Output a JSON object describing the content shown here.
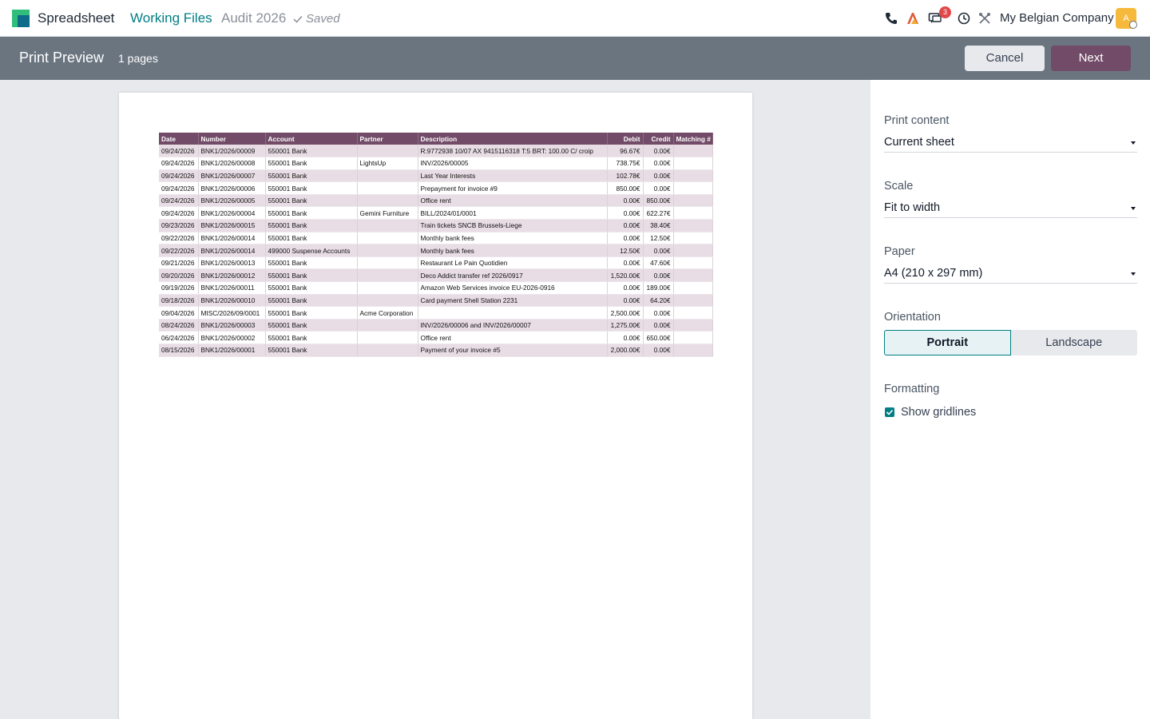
{
  "topbar": {
    "app_name": "Spreadsheet",
    "breadcrumb": [
      "Working Files",
      "Audit 2026"
    ],
    "saved_label": "Saved",
    "messages_badge": "3",
    "company": "My Belgian Company",
    "avatar_letter": "A",
    "colors": {
      "brand": "#714b67",
      "accent": "#017e84"
    }
  },
  "controlbar": {
    "title": "Print Preview",
    "pages": "1 pages",
    "cancel_label": "Cancel",
    "next_label": "Next"
  },
  "sheet": {
    "headers": [
      "Date",
      "Number",
      "Account",
      "Partner",
      "Description",
      "Debit",
      "Credit",
      "Matching #"
    ],
    "rows": [
      [
        "09/24/2026",
        "BNK1/2026/00009",
        "550001 Bank",
        "",
        "R:9772938 10/07 AX 9415116318 T:5 BRT: 100.00 C/ croip",
        "96.67€",
        "0.00€",
        ""
      ],
      [
        "09/24/2026",
        "BNK1/2026/00008",
        "550001 Bank",
        "LightsUp",
        "INV/2026/00005",
        "738.75€",
        "0.00€",
        ""
      ],
      [
        "09/24/2026",
        "BNK1/2026/00007",
        "550001 Bank",
        "",
        "Last Year Interests",
        "102.78€",
        "0.00€",
        ""
      ],
      [
        "09/24/2026",
        "BNK1/2026/00006",
        "550001 Bank",
        "",
        "Prepayment for invoice #9",
        "850.00€",
        "0.00€",
        ""
      ],
      [
        "09/24/2026",
        "BNK1/2026/00005",
        "550001 Bank",
        "",
        "Office rent",
        "0.00€",
        "850.00€",
        ""
      ],
      [
        "09/24/2026",
        "BNK1/2026/00004",
        "550001 Bank",
        "Gemini Furniture",
        "BILL/2024/01/0001",
        "0.00€",
        "622.27€",
        ""
      ],
      [
        "09/23/2026",
        "BNK1/2026/00015",
        "550001 Bank",
        "",
        "Train tickets SNCB Brussels-Liege",
        "0.00€",
        "38.40€",
        ""
      ],
      [
        "09/22/2026",
        "BNK1/2026/00014",
        "550001 Bank",
        "",
        "Monthly bank fees",
        "0.00€",
        "12.50€",
        ""
      ],
      [
        "09/22/2026",
        "BNK1/2026/00014",
        "499000 Suspense Accounts",
        "",
        "Monthly bank fees",
        "12.50€",
        "0.00€",
        ""
      ],
      [
        "09/21/2026",
        "BNK1/2026/00013",
        "550001 Bank",
        "",
        "Restaurant Le Pain Quotidien",
        "0.00€",
        "47.60€",
        ""
      ],
      [
        "09/20/2026",
        "BNK1/2026/00012",
        "550001 Bank",
        "",
        "Deco Addict transfer ref 2026/0917",
        "1,520.00€",
        "0.00€",
        ""
      ],
      [
        "09/19/2026",
        "BNK1/2026/00011",
        "550001 Bank",
        "",
        "Amazon Web Services invoice EU-2026-0916",
        "0.00€",
        "189.00€",
        ""
      ],
      [
        "09/18/2026",
        "BNK1/2026/00010",
        "550001 Bank",
        "",
        "Card payment Shell Station 2231",
        "0.00€",
        "64.20€",
        ""
      ],
      [
        "09/04/2026",
        "MISC/2026/09/0001",
        "550001 Bank",
        "Acme Corporation",
        "",
        "2,500.00€",
        "0.00€",
        ""
      ],
      [
        "08/24/2026",
        "BNK1/2026/00003",
        "550001 Bank",
        "",
        "INV/2026/00006 and INV/2026/00007",
        "1,275.00€",
        "0.00€",
        ""
      ],
      [
        "06/24/2026",
        "BNK1/2026/00002",
        "550001 Bank",
        "",
        "Office rent",
        "0.00€",
        "650.00€",
        ""
      ],
      [
        "08/15/2026",
        "BNK1/2026/00001",
        "550001 Bank",
        "",
        "Payment of your invoice #5",
        "2,000.00€",
        "0.00€",
        ""
      ]
    ]
  },
  "settings": {
    "print_content": {
      "label": "Print content",
      "value": "Current sheet"
    },
    "scale": {
      "label": "Scale",
      "value": "Fit to width"
    },
    "paper": {
      "label": "Paper",
      "value": "A4 (210 x 297 mm)"
    },
    "orientation": {
      "label": "Orientation",
      "options": [
        "Portrait",
        "Landscape"
      ],
      "selected": "Portrait"
    },
    "formatting": {
      "label": "Formatting",
      "gridlines_label": "Show gridlines",
      "gridlines_checked": true
    }
  }
}
